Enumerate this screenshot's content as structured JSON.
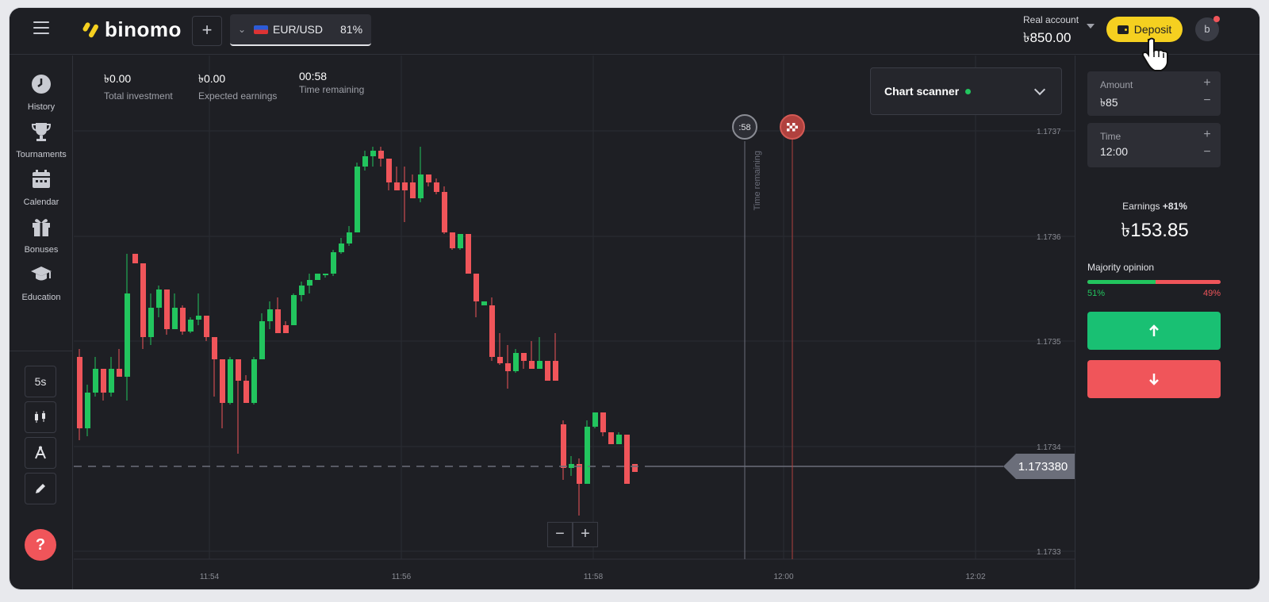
{
  "header": {
    "logo_text": "binomo",
    "add_tab_symbol": "+",
    "asset": {
      "name": "EUR/USD",
      "payout": "81%"
    },
    "account_label": "Real account",
    "account_balance": "৳850.00",
    "deposit_label": "Deposit",
    "avatar_initial": "b"
  },
  "nav": {
    "items": [
      {
        "label": "History",
        "icon": "clock-icon"
      },
      {
        "label": "Tournaments",
        "icon": "trophy-icon"
      },
      {
        "label": "Calendar",
        "icon": "calendar-icon"
      },
      {
        "label": "Bonuses",
        "icon": "gift-icon"
      },
      {
        "label": "Education",
        "icon": "graduation-cap-icon"
      }
    ],
    "timeframe": "5s",
    "help": "?"
  },
  "stats": {
    "total_investment_value": "৳0.00",
    "total_investment_label": "Total investment",
    "expected_earnings_value": "৳0.00",
    "expected_earnings_label": "Expected earnings",
    "time_remaining_value": "00:58",
    "time_remaining_label": "Time remaining"
  },
  "scanner": {
    "label": "Chart scanner",
    "status_color": "#22c55e"
  },
  "chart_data": {
    "type": "candlestick",
    "y_ticks": [
      "1.1737",
      "1.1736",
      "1.1735",
      "1.1734",
      "1.1733"
    ],
    "x_ticks": [
      "11:54",
      "11:56",
      "11:58",
      "12:00",
      "12:02"
    ],
    "current_price": "1.173380",
    "time_marker_label": ":58",
    "time_marker_text": "Time remaining",
    "colors": {
      "up": "#22c55e",
      "down": "#f0555a",
      "grid": "#2a2c33"
    }
  },
  "zoom": {
    "minus": "−",
    "plus": "+"
  },
  "trade": {
    "amount_label": "Amount",
    "amount_value": "৳85",
    "time_label": "Time",
    "time_value": "12:00",
    "earnings_label": "Earnings",
    "earnings_pct": "+81%",
    "earnings_value": "৳153.85",
    "majority_label": "Majority opinion",
    "majority_up": "51%",
    "majority_down": "49%",
    "majority_up_fraction": 0.51
  }
}
